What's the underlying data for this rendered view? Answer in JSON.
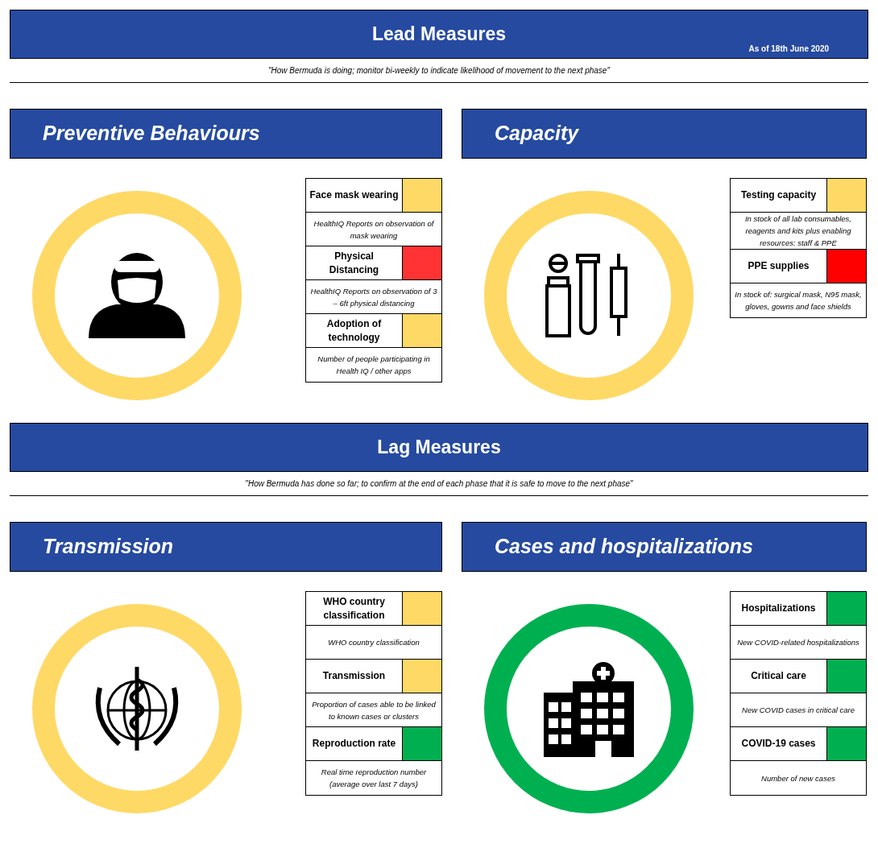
{
  "sections": [
    {
      "title": "Lead Measures",
      "date": "As of 18th June 2020",
      "subtitle": "\"How Bermuda is doing; monitor bi-weekly to indicate likelihood of movement to the next phase\"",
      "panels": [
        {
          "title": "Preventive Behaviours",
          "kind": "mask-person",
          "color": "#ffd966",
          "indicators": [
            {
              "name": "Face mask wearing",
              "color": "#ffd966",
              "description": "HealthIQ Reports on observation of mask wearing"
            },
            {
              "name": "Physical Distancing",
              "color": "#ff3333",
              "description": "HealthIQ Reports on observation of 3 – 6ft physical distancing"
            },
            {
              "name": "Adoption of technology",
              "color": "#ffd966",
              "description": "Number of people participating in Health IQ / other apps"
            }
          ]
        },
        {
          "title": "Capacity",
          "kind": "lab-equipment",
          "color": "#ffd966",
          "indicators": [
            {
              "name": "Testing capacity",
              "color": "#ffd966",
              "description": "In stock of all lab consumables, reagents and kits plus enabling resources: staff & PPE"
            },
            {
              "name": "PPE supplies",
              "color": "#ff0000",
              "description": "In stock of: surgical mask, N95 mask, gloves, gowns and face shields"
            }
          ]
        }
      ]
    },
    {
      "title": "Lag Measures",
      "subtitle": "\"How Bermuda has done so far; to confirm at the end of each phase that it is safe to move to the next phase\"",
      "panels": [
        {
          "title": "Transmission",
          "kind": "emblem",
          "color": "#ffd966",
          "indicators": [
            {
              "name": "WHO country classification",
              "color": "#ffd966",
              "description": "WHO country classification"
            },
            {
              "name": "Transmission",
              "color": "#ffd966",
              "description": "Proportion of cases able to be linked to known cases or clusters"
            },
            {
              "name": "Reproduction rate",
              "color": "#00b050",
              "description": "Real time reproduction number (average over last 7 days)"
            }
          ]
        },
        {
          "title": "Cases and hospitalizations",
          "kind": "hospital",
          "color": "#00b050",
          "indicators": [
            {
              "name": "Hospitalizations",
              "color": "#00b050",
              "description": "New COVID-related hospitalizations"
            },
            {
              "name": "Critical care",
              "color": "#00b050",
              "description": "New COVID cases in critical care"
            },
            {
              "name": "COVID-19 cases",
              "color": "#00b050",
              "description": "Number of new cases"
            }
          ]
        }
      ]
    }
  ]
}
